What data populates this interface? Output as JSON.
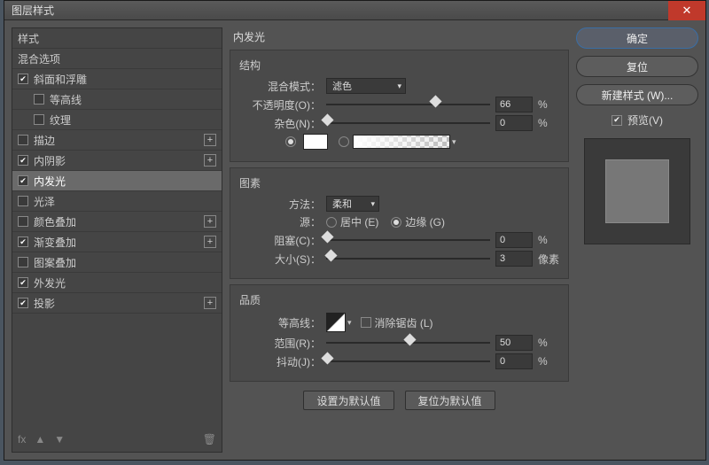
{
  "title": "图层样式",
  "left": {
    "styles_header": "样式",
    "blending_header": "混合选项",
    "items": [
      {
        "label": "斜面和浮雕",
        "checked": true,
        "sub": false,
        "plus": false
      },
      {
        "label": "等高线",
        "checked": false,
        "sub": true,
        "plus": false
      },
      {
        "label": "纹理",
        "checked": false,
        "sub": true,
        "plus": false
      },
      {
        "label": "描边",
        "checked": false,
        "sub": false,
        "plus": true
      },
      {
        "label": "内阴影",
        "checked": true,
        "sub": false,
        "plus": true
      },
      {
        "label": "内发光",
        "checked": true,
        "sub": false,
        "plus": false,
        "selected": true
      },
      {
        "label": "光泽",
        "checked": false,
        "sub": false,
        "plus": false
      },
      {
        "label": "颜色叠加",
        "checked": false,
        "sub": false,
        "plus": true
      },
      {
        "label": "渐变叠加",
        "checked": true,
        "sub": false,
        "plus": true
      },
      {
        "label": "图案叠加",
        "checked": false,
        "sub": false,
        "plus": false
      },
      {
        "label": "外发光",
        "checked": true,
        "sub": false,
        "plus": false
      },
      {
        "label": "投影",
        "checked": true,
        "sub": false,
        "plus": true
      }
    ],
    "fx": "fx"
  },
  "mid": {
    "title": "内发光",
    "structure": {
      "title": "结构",
      "blend_mode_label": "混合模式：",
      "blend_mode_value": "滤色",
      "opacity_label": "不透明度(O)：",
      "opacity_value": "66",
      "noise_label": "杂色(N)：",
      "noise_value": "0",
      "percent": "%"
    },
    "elements": {
      "title": "图素",
      "technique_label": "方法：",
      "technique_value": "柔和",
      "source_label": "源：",
      "center": "居中 (E)",
      "edge": "边缘 (G)",
      "choke_label": "阻塞(C)：",
      "choke_value": "0",
      "size_label": "大小(S)：",
      "size_value": "3",
      "percent": "%",
      "px": "像素"
    },
    "quality": {
      "title": "品质",
      "contour_label": "等高线：",
      "antialias": "消除锯齿 (L)",
      "range_label": "范围(R)：",
      "range_value": "50",
      "jitter_label": "抖动(J)：",
      "jitter_value": "0",
      "percent": "%"
    },
    "set_default": "设置为默认值",
    "reset_default": "复位为默认值"
  },
  "right": {
    "ok": "确定",
    "cancel": "复位",
    "new_style": "新建样式 (W)...",
    "preview": "预览(V)"
  }
}
